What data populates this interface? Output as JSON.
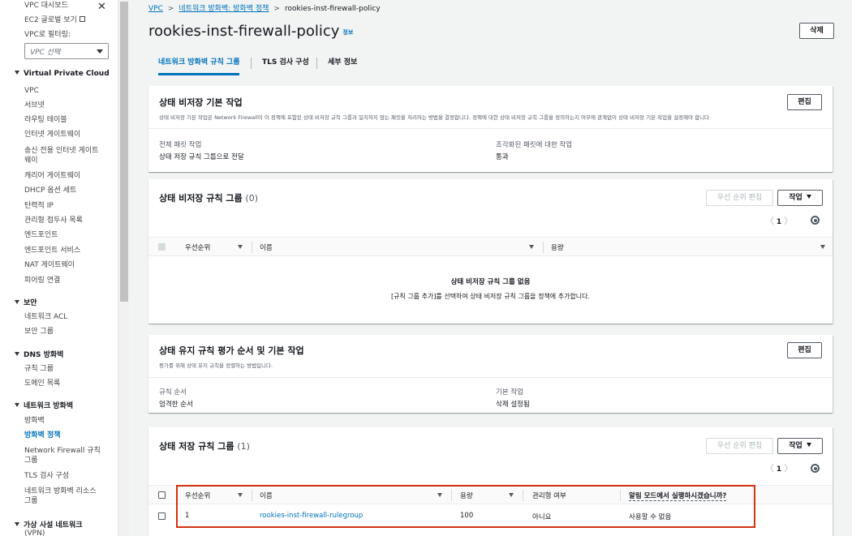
{
  "sidebar": {
    "top_items": [
      "VPC 대시보드",
      "EC2 글로벌 보기",
      "VPC로 필터링:"
    ],
    "vpc_select_placeholder": "VPC 선택",
    "sections": [
      {
        "title": "Virtual Private Cloud",
        "items": [
          "VPC",
          "서브넷",
          "라우팅 테이블",
          "인터넷 게이트웨이",
          "송신 전용 인터넷 게이트",
          "웨이",
          "캐리어 게이트웨이",
          "DHCP 옵션 세트",
          "탄력적 IP",
          "관리형 접두사 목록",
          "엔드포인트",
          "엔드포인트 서비스",
          "NAT 게이트웨이",
          "피어링 연결"
        ]
      },
      {
        "title": "보안",
        "items": [
          "네트워크 ACL",
          "보안 그룹"
        ]
      },
      {
        "title": "DNS 방화벽",
        "items": [
          "규칙 그룹",
          "도메인 목록"
        ]
      },
      {
        "title": "네트워크 방화벽",
        "items": [
          "방화벽",
          "방화벽 정책",
          "Network Firewall 규칙",
          "그룹",
          "TLS 검사 구성",
          "네트워크 방화벽 리소스",
          "그룹"
        ]
      },
      {
        "title": "가상 사설 네트워크",
        "items": [
          "(VPN)"
        ]
      }
    ]
  },
  "breadcrumb": {
    "root": "VPC",
    "parent": "네트워크 방화벽: 방화벽 정책",
    "current": "rookies-inst-firewall-policy"
  },
  "page": {
    "title": "rookies-inst-firewall-policy",
    "info": "정보",
    "delete_label": "삭제"
  },
  "tabs": [
    "네트워크 방화벽 규칙 그룹",
    "TLS 검사 구성",
    "세부 정보"
  ],
  "stateless_default": {
    "title": "상태 비저장 기본 작업",
    "desc": "상태 비저장 기본 작업은 Network Firewall이 이 정책에 포함된 상태 비저장 규칙 그룹과 일치하지 않는 패킷을 처리하는 방법을 결정합니다. 정책에 대한 상태 비저장 규칙 그룹을 정의하는지 여부에 관계없이 상태 비저장 기본 작업을 설정해야 합니다.",
    "edit_label": "편집",
    "full_packet_label": "전체 패킷 작업",
    "full_packet_value": "상태 저장 규칙 그룹으로 전달",
    "fragment_label": "조각화된 패킷에 대한 작업",
    "fragment_value": "통과"
  },
  "stateless_groups": {
    "title": "상태 비저장 규칙 그룹",
    "count": "(0)",
    "priority_edit_label": "우선 순위 편집",
    "actions_label": "작업",
    "page": "1",
    "columns": [
      "우선순위",
      "이름",
      "용량"
    ],
    "empty_title": "상태 비저장 규칙 그룹 없음",
    "empty_desc": "[규칙 그룹 추가]를 선택하여 상태 비저장 규칙 그룹을 정책에 추가합니다."
  },
  "stateful_order": {
    "title": "상태 유지 규칙 평가 순서 및 기본 작업",
    "desc": "평가를 위해 상태 유지 규칙을 정렬하는 방법입니다.",
    "edit_label": "편집",
    "rule_order_label": "규칙 순서",
    "rule_order_value": "엄격한 순서",
    "default_action_label": "기본 작업",
    "default_action_value": "삭제 설정됨"
  },
  "stateful_groups": {
    "title": "상태 저장 규칙 그룹",
    "count": "(1)",
    "priority_edit_label": "우선 순위 편집",
    "actions_label": "작업",
    "page": "1",
    "columns": [
      "우선순위",
      "이름",
      "용량",
      "관리형 여부",
      "알림 모드에서 실행하시겠습니까?"
    ],
    "rows": [
      {
        "priority": "1",
        "name": "rookies-inst-firewall-rulegroup",
        "capacity": "100",
        "managed": "아니요",
        "alert_mode": "사용할 수 없음"
      }
    ]
  },
  "colors": {
    "link": "#0073bb",
    "highlight": "#d13212"
  }
}
